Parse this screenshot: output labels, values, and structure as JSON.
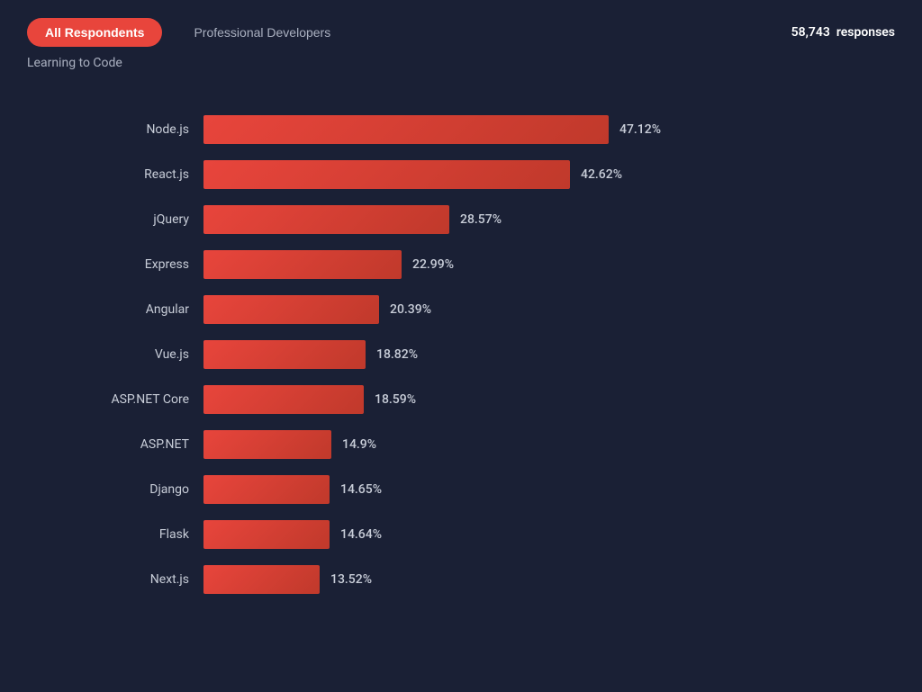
{
  "header": {
    "tab_active": "All Respondents",
    "tab_inactive": "Professional Developers",
    "responses_label": "responses",
    "responses_count": "58,743",
    "subtitle": "Learning to Code"
  },
  "chart": {
    "max_percent": 47.12,
    "bars": [
      {
        "label": "Node.js",
        "value": 47.12,
        "display": "47.12%"
      },
      {
        "label": "React.js",
        "value": 42.62,
        "display": "42.62%"
      },
      {
        "label": "jQuery",
        "value": 28.57,
        "display": "28.57%"
      },
      {
        "label": "Express",
        "value": 22.99,
        "display": "22.99%"
      },
      {
        "label": "Angular",
        "value": 20.39,
        "display": "20.39%"
      },
      {
        "label": "Vue.js",
        "value": 18.82,
        "display": "18.82%"
      },
      {
        "label": "ASP.NET Core",
        "value": 18.59,
        "display": "18.59%"
      },
      {
        "label": "ASP.NET",
        "value": 14.9,
        "display": "14.9%"
      },
      {
        "label": "Django",
        "value": 14.65,
        "display": "14.65%"
      },
      {
        "label": "Flask",
        "value": 14.64,
        "display": "14.64%"
      },
      {
        "label": "Next.js",
        "value": 13.52,
        "display": "13.52%"
      }
    ]
  },
  "colors": {
    "bg": "#1a2035",
    "bar_gradient_start": "#e8453c",
    "bar_gradient_end": "#c0392b",
    "active_tab_bg": "#e8453c",
    "text_muted": "#aab0c0",
    "text_white": "#ffffff"
  }
}
